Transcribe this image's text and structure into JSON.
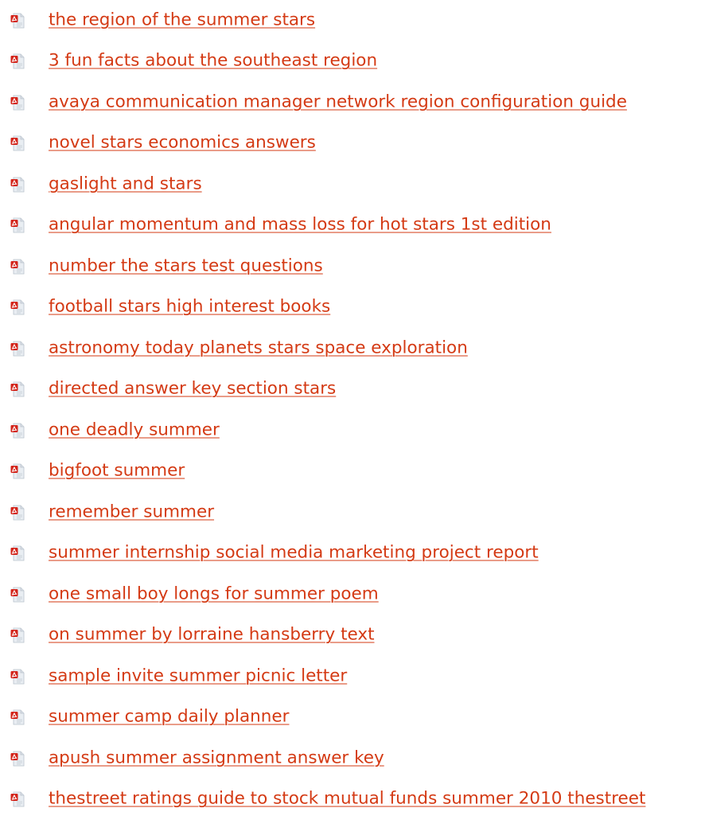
{
  "icon": {
    "name": "pdf-file-icon",
    "page_color": "#e9eef3",
    "badge_color": "#d3251b",
    "badge_glyph_color": "#ffffff"
  },
  "link_color": "#d43a14",
  "items": [
    {
      "label": "the region of the summer stars"
    },
    {
      "label": "3 fun facts about the southeast region"
    },
    {
      "label": "avaya communication manager network region configuration guide"
    },
    {
      "label": "novel stars economics answers"
    },
    {
      "label": "gaslight and stars"
    },
    {
      "label": "angular momentum and mass loss for hot stars 1st edition"
    },
    {
      "label": "number the stars test questions"
    },
    {
      "label": "football stars high interest books"
    },
    {
      "label": "astronomy today planets stars space exploration"
    },
    {
      "label": "directed answer key section stars"
    },
    {
      "label": "one deadly summer"
    },
    {
      "label": "bigfoot summer"
    },
    {
      "label": "remember summer"
    },
    {
      "label": "summer internship social media marketing project report"
    },
    {
      "label": "one small boy longs for summer poem"
    },
    {
      "label": "on summer by lorraine hansberry text"
    },
    {
      "label": "sample invite summer picnic letter"
    },
    {
      "label": "summer camp daily planner"
    },
    {
      "label": "apush summer assignment answer key"
    },
    {
      "label": "thestreet ratings guide to stock mutual funds summer 2010 thestreet"
    }
  ]
}
